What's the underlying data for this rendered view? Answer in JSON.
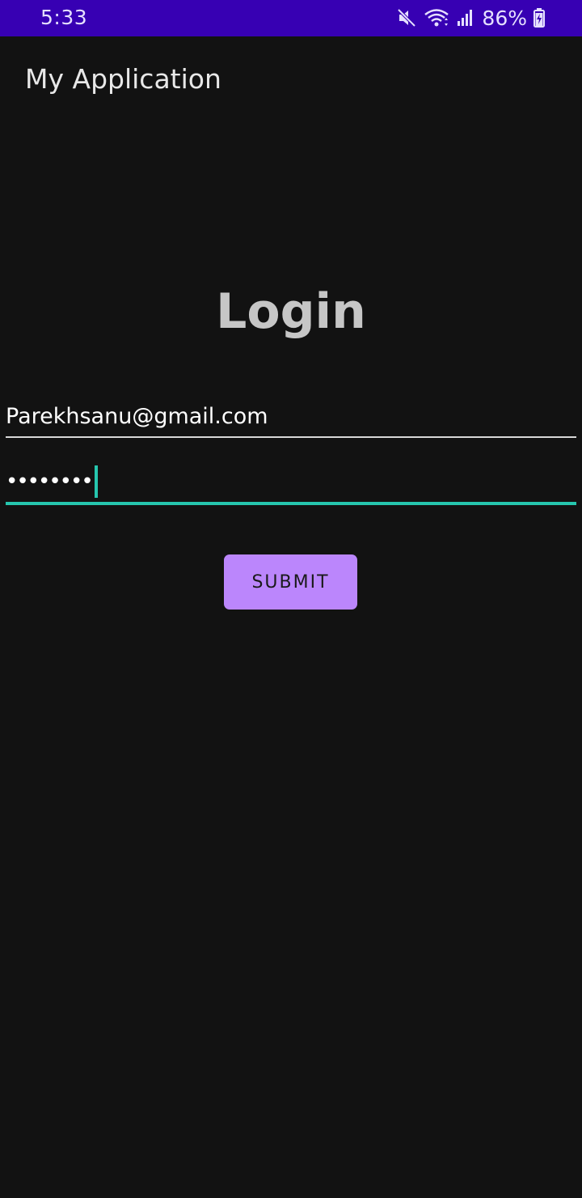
{
  "status_bar": {
    "time": "5:33",
    "battery_percent": "86%",
    "icons": [
      "mute-icon",
      "wifi-icon",
      "signal-icon",
      "battery-charging-icon"
    ]
  },
  "app_bar": {
    "title": "My Application"
  },
  "login": {
    "heading": "Login",
    "email_value": "Parekhsanu@gmail.com",
    "password_masked": "••••••••",
    "submit_label": "SUBMIT"
  },
  "colors": {
    "status_bar_bg": "#3700b3",
    "background": "#121212",
    "accent_teal": "#26c6ae",
    "button_purple": "#bb86fc"
  }
}
